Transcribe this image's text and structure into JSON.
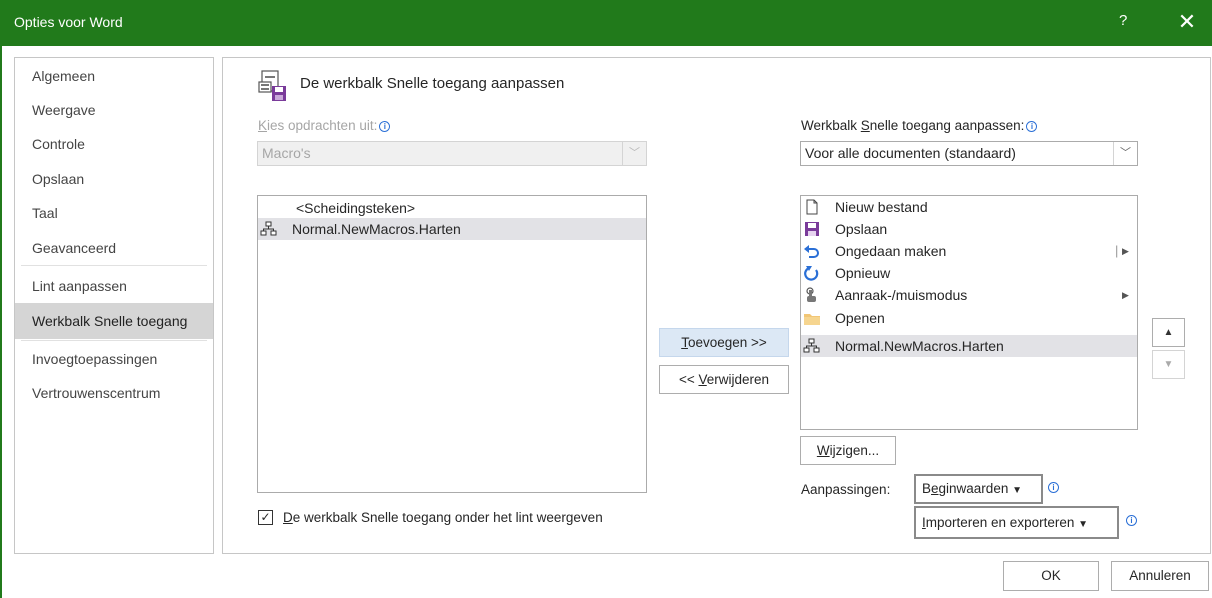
{
  "window": {
    "title": "Opties voor Word",
    "help": "?",
    "close": "✕"
  },
  "nav": {
    "items": [
      {
        "label": "Algemeen"
      },
      {
        "label": "Weergave"
      },
      {
        "label": "Controle"
      },
      {
        "label": "Opslaan"
      },
      {
        "label": "Taal"
      },
      {
        "label": "Geavanceerd"
      },
      {
        "label": "Lint aanpassen"
      },
      {
        "label": "Werkbalk Snelle toegang",
        "selected": true
      },
      {
        "label": "Invoegtoepassingen"
      },
      {
        "label": "Vertrouwenscentrum"
      }
    ]
  },
  "section": {
    "title": "De werkbalk Snelle toegang aanpassen"
  },
  "choose": {
    "label_accel": "K",
    "label_rest": "ies opdrachten uit:",
    "value": "Macro's",
    "items": [
      {
        "label": "<Scheidingsteken>"
      },
      {
        "label": "Normal.NewMacros.Harten",
        "icon": "macro-icon",
        "selected": true
      }
    ]
  },
  "toolbar": {
    "label_pre": "Werkbalk ",
    "label_accel": "S",
    "label_rest": "nelle toegang aanpassen:",
    "value": "Voor alle documenten (standaard)",
    "items": [
      {
        "label": "Nieuw bestand",
        "icon": "new-document-icon"
      },
      {
        "label": "Opslaan",
        "icon": "save-icon"
      },
      {
        "label": "Ongedaan maken",
        "icon": "undo-icon"
      },
      {
        "label": "Opnieuw",
        "icon": "redo-icon"
      },
      {
        "label": "Aanraak-/muismodus",
        "icon": "touch-mode-icon"
      },
      {
        "label": "Openen",
        "icon": "folder-icon"
      },
      {
        "label": "Normal.NewMacros.Harten",
        "icon": "macro-icon",
        "selected": true
      }
    ]
  },
  "buttons": {
    "add_accel": "T",
    "add_rest": "oevoegen >>",
    "remove_pre": "<< ",
    "remove_accel": "V",
    "remove_rest": "erwijderen",
    "modify_accel": "W",
    "modify_rest": "ijzigen...",
    "up": "▲",
    "down": "▼",
    "ok": "OK",
    "cancel": "Annuleren"
  },
  "customizations": {
    "label": "Aanpassingen:",
    "reset_accel": "e",
    "reset_pre": "B",
    "reset_rest": "ginwaarden",
    "import_accel": "I",
    "import_rest": "mporteren en exporteren"
  },
  "checkbox": {
    "checked": true,
    "label_accel": "D",
    "label_rest": "e werkbalk Snelle toegang onder het lint weergeven"
  },
  "colors": {
    "titlebar": "#217a1b",
    "selected_nav": "#d5d5d5",
    "primary_button": "#dce8f5"
  }
}
